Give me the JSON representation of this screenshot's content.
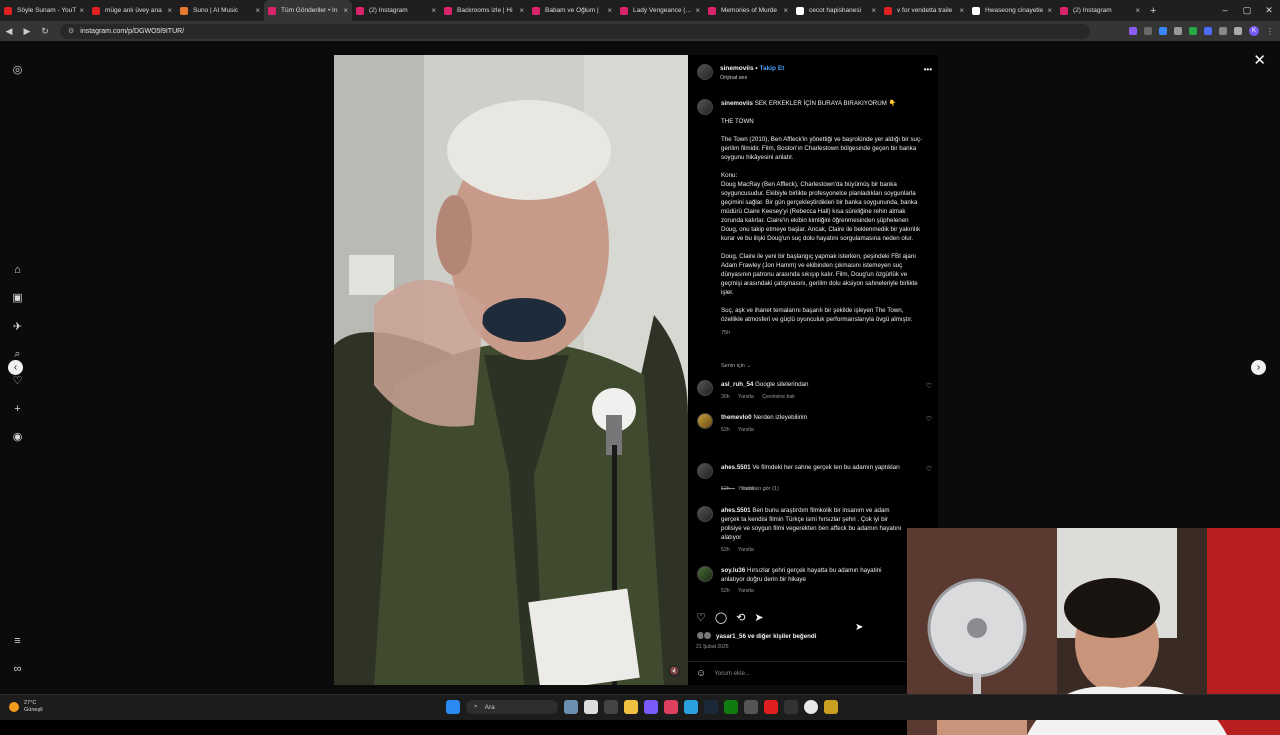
{
  "browser": {
    "tabs": [
      {
        "title": "Söyle Sunam - YouT",
        "color": "#e02020"
      },
      {
        "title": "müge anlı üvey ana",
        "color": "#e02020"
      },
      {
        "title": "Suno | AI Music",
        "color": "#e87a30"
      },
      {
        "title": "Tüm Gönderiler • In",
        "color": "#d6246e",
        "active": true
      },
      {
        "title": "(2) Instagram",
        "color": "#d6246e"
      },
      {
        "title": "Backrooms izle | Hi",
        "color": "#d6246e"
      },
      {
        "title": "Babam ve Oğlum |",
        "color": "#d6246e"
      },
      {
        "title": "Lady Vengeance (20",
        "color": "#d6246e"
      },
      {
        "title": "Memories of Murde",
        "color": "#d6246e"
      },
      {
        "title": "cecot hapishanesi",
        "color": "#ffffff"
      },
      {
        "title": "v for vendetta traile",
        "color": "#e02020"
      },
      {
        "title": "Hwaseong cinayetle",
        "color": "#ffffff"
      },
      {
        "title": "(2) Instagram",
        "color": "#d6246e"
      }
    ],
    "new_tab": "+",
    "url": "instagram.com/p/DGWO5l9ITUR/",
    "profile_initial": "K"
  },
  "post": {
    "username": "sinemoviis",
    "follow": "Takip Et",
    "audio": "Orijinal ses",
    "caption_title": "SEK ERKEKLER İÇİN BURAYA BIRAKIYORUM 👇",
    "paragraphs": [
      "THE TOWN",
      "The Town (2010), Ben Affleck'in yönettiği ve başrolünde yer aldığı bir suç-gerilim filmidir. Film, Boston'ın Charlestown bölgesinde geçen bir banka soygunu hikâyesini anlatır.",
      "Konu:\nDoug MacRay (Ben Affleck), Charlestown'da büyümüş bir banka soyguncusudur. Ekibiyle birlikte profesyonelce planladıkları soygunlarla geçimini sağlar. Bir gün gerçekleştirdikleri bir banka soygununda, banka müdürü Claire Keesey'yi (Rebecca Hall) kısa süreliğine rehin almak zorunda kalırlar. Claire'in ekibin kimliğini öğrenmesinden şüphelenen Doug, onu takip etmeye başlar. Ancak, Claire ile beklenmedik bir yakınlık kurar ve bu ilişki Doug'un suç dolu hayatını sorgulamasına neden olur.",
      "Doug, Claire ile yeni bir başlangıç yapmak isterken, peşindeki FBI ajanı Adam Frawley (Jon Hamm) ve ekibinden çıkmasını istemeyen suç dünyasının patronu arasında sıkışıp kalır. Film, Doug'un özgürlük ve geçmişi arasındaki çatışmasını, gerilim dolu aksiyon sahneleriyle birlikte işler.",
      "Suç, aşk ve ihanet temalarını başarılı bir şekilde işleyen The Town, özellikle atmosferi ve güçlü oyunculuk performanslarıyla övgü almıştır."
    ],
    "time": "75h",
    "relevant": "Senin için ⌄",
    "comments": [
      {
        "user": "asl_ruh_54",
        "text": "Google sitelerindan",
        "time": "30h",
        "reply": "Yanıtla",
        "extra": "Çevirisine bak"
      },
      {
        "user": "themevlo0",
        "text": "Nerden izleyebilirim",
        "time": "52h",
        "reply": "Yanıtla",
        "extra": ""
      },
      {
        "user": "ahes.5501",
        "text": "Ve filmdeki her sahne gerçek ten bu adamın yaptıkları",
        "time": "52h",
        "reply": "Yanıtla",
        "extra": ""
      },
      {
        "user": "ahes.5501",
        "text": "Ben bunu araştırdım filmkolik bir insanım ve adam gerçek ta kendisi filmin Türkçe ismi hırsızlar şehri . Çok iyi bir polisiye ve soygun filmi vegerekten ben affeck bu adamın hayatını alatıyor",
        "time": "52h",
        "reply": "Yanıtla",
        "extra": ""
      },
      {
        "user": "soy.lu36",
        "text": "Hırsızlar şehri gerçek hayatta bu adamın hayatini anlatıyor doğru derin bir hikaye",
        "time": "52h",
        "reply": "Yanıtla",
        "extra": ""
      }
    ],
    "view_replies": "Yanıtları gör (1)",
    "liked_by": "yasar1_56 ve diğer kişiler beğendi",
    "date": "21 Şubat 2025",
    "comment_placeholder": "Yorum ekle..."
  },
  "taskbar": {
    "weather_temp": "27°C",
    "weather_desc": "Güneşli",
    "search": "Ara"
  }
}
